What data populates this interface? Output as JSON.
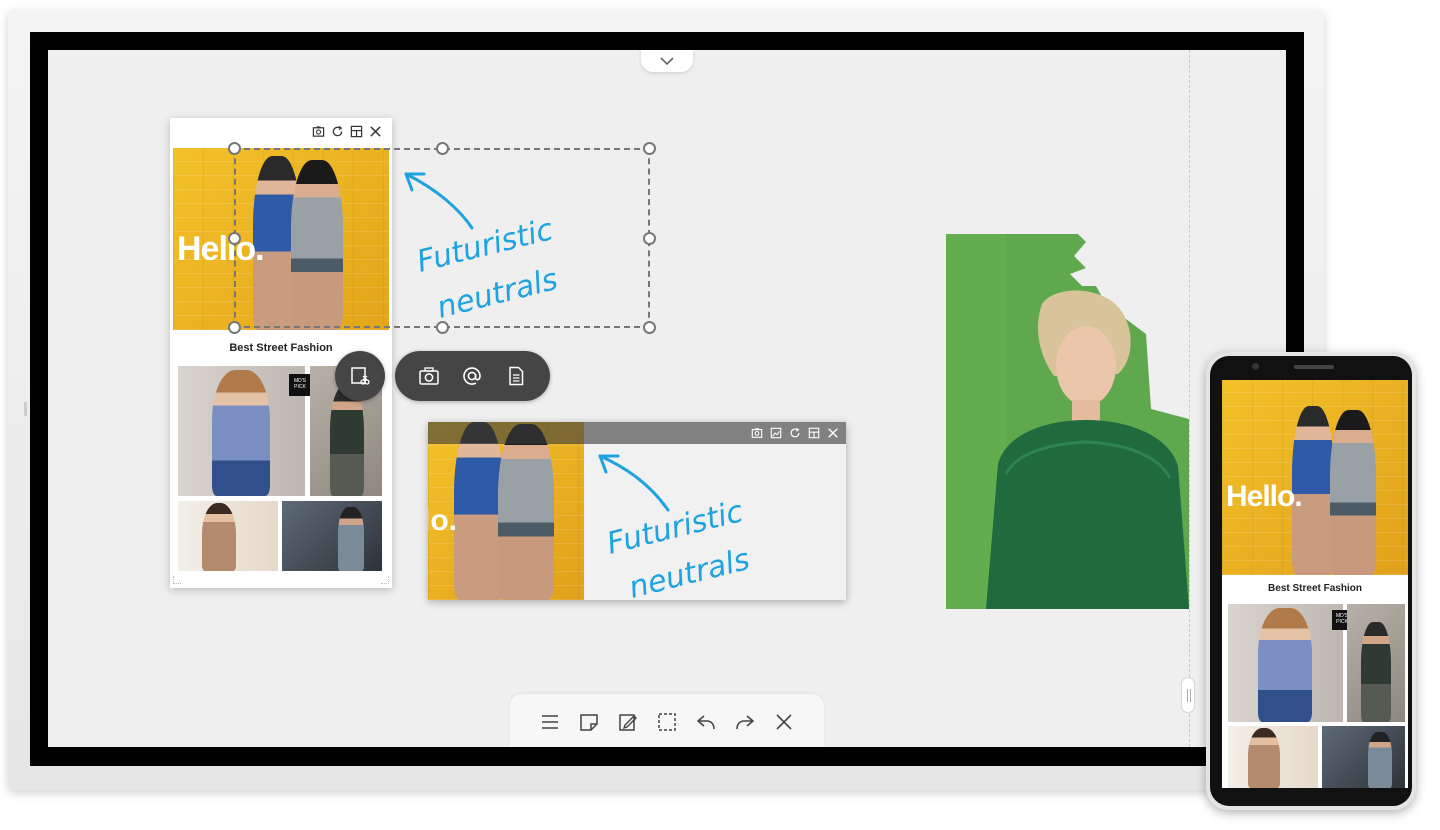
{
  "doc_card": {
    "hero_text": "Hello.",
    "title": "Best Street Fashion",
    "badge_line1": "MD'S",
    "badge_line2": "PICK",
    "toolbar_icons": [
      "capture-icon",
      "rotate-icon",
      "layout-icon",
      "close-icon"
    ]
  },
  "annotation": {
    "line1": "Futuristic",
    "line2": "neutrals"
  },
  "capture_menu": {
    "icons": [
      "screen-capture-icon",
      "camera-icon",
      "mention-icon",
      "document-icon"
    ]
  },
  "clip_window": {
    "hero_text": "lo.",
    "annotation_line1": "Futuristic",
    "annotation_line2": "neutrals",
    "toolbar_icons": [
      "capture-icon",
      "image-icon",
      "rotate-icon",
      "layout-icon",
      "close-icon"
    ]
  },
  "bottom_toolbar": {
    "icons": [
      "menu-icon",
      "sticky-note-icon",
      "edit-note-icon",
      "select-area-icon",
      "undo-icon",
      "redo-icon",
      "close-icon"
    ]
  },
  "phone": {
    "hero_text": "Hello.",
    "title": "Best Street Fashion",
    "badge_line1": "MD'S",
    "badge_line2": "PICK"
  },
  "colors": {
    "annotation_blue": "#1ea3e0",
    "hero_yellow": "#f3c12a",
    "photo_green": "#5fa84d",
    "toolbar_dark": "#454545"
  }
}
